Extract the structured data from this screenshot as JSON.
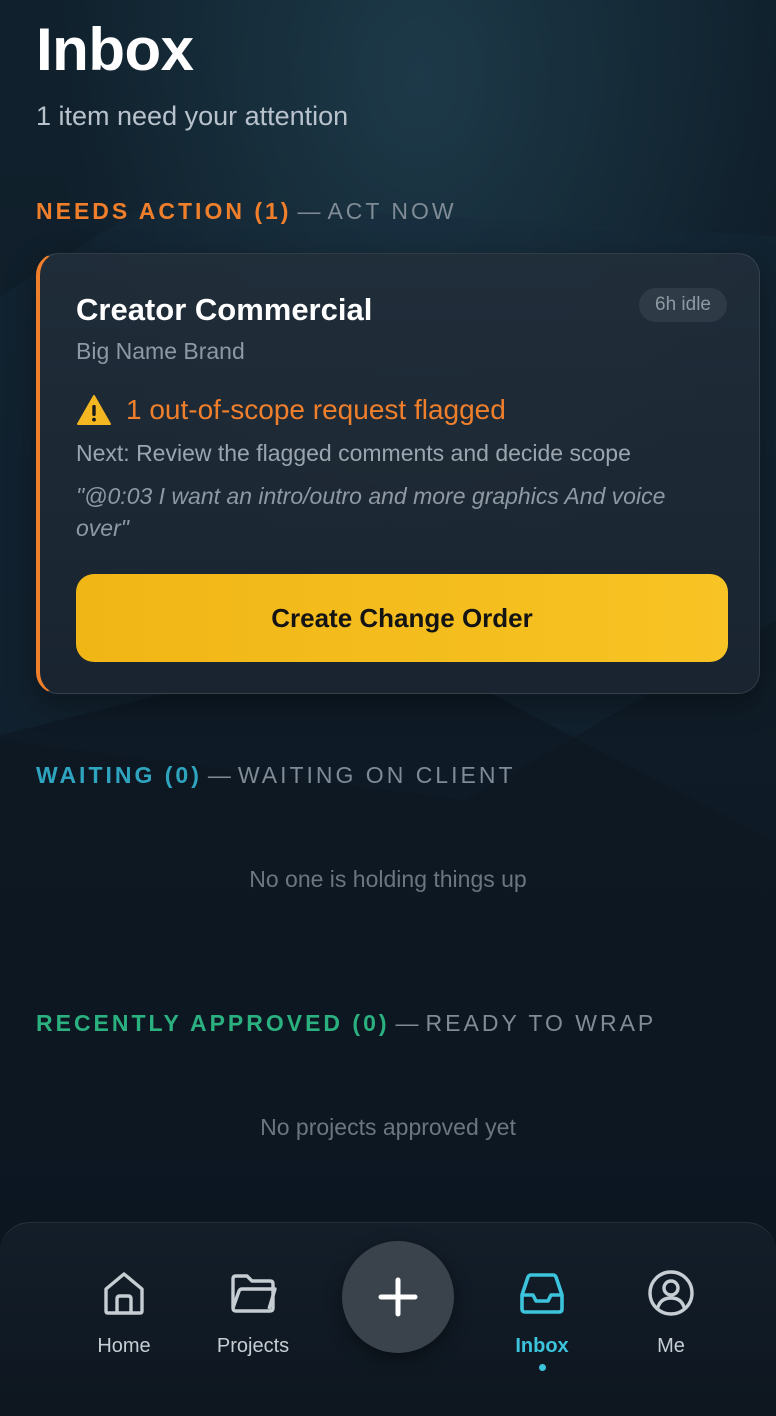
{
  "header": {
    "title": "Inbox",
    "subtitle": "1 item need your attention"
  },
  "sections": {
    "needs_action": {
      "label": "NEEDS ACTION (1)",
      "dash": "—",
      "hint": "ACT NOW",
      "color": "#f07f2c"
    },
    "waiting": {
      "label": "WAITING (0)",
      "dash": "—",
      "hint": "WAITING ON CLIENT",
      "empty_text": "No one is holding things up",
      "color": "#2fa4bf"
    },
    "recently_approved": {
      "label": "RECENTLY APPROVED (0)",
      "dash": "—",
      "hint": "READY TO WRAP",
      "empty_text": "No projects approved yet",
      "color": "#2bb07f"
    }
  },
  "card": {
    "title": "Creator Commercial",
    "client": "Big Name Brand",
    "idle_badge": "6h idle",
    "flag_icon": "warning-icon",
    "flag_text": "1 out-of-scope request flagged",
    "next_text": "Next: Review the flagged comments and decide scope",
    "quote": "\"@0:03 I want an intro/outro and more graphics And voice over\"",
    "button_label": "Create Change Order",
    "button_color": "#f8c324"
  },
  "tabbar": {
    "items": [
      {
        "label": "Home",
        "icon": "home-icon",
        "active": false
      },
      {
        "label": "Projects",
        "icon": "folder-icon",
        "active": false
      },
      {
        "label": "",
        "icon": "plus-icon",
        "active": false
      },
      {
        "label": "Inbox",
        "icon": "inbox-icon",
        "active": true
      },
      {
        "label": "Me",
        "icon": "user-icon",
        "active": false
      }
    ],
    "active_color": "#3cc4dc"
  }
}
